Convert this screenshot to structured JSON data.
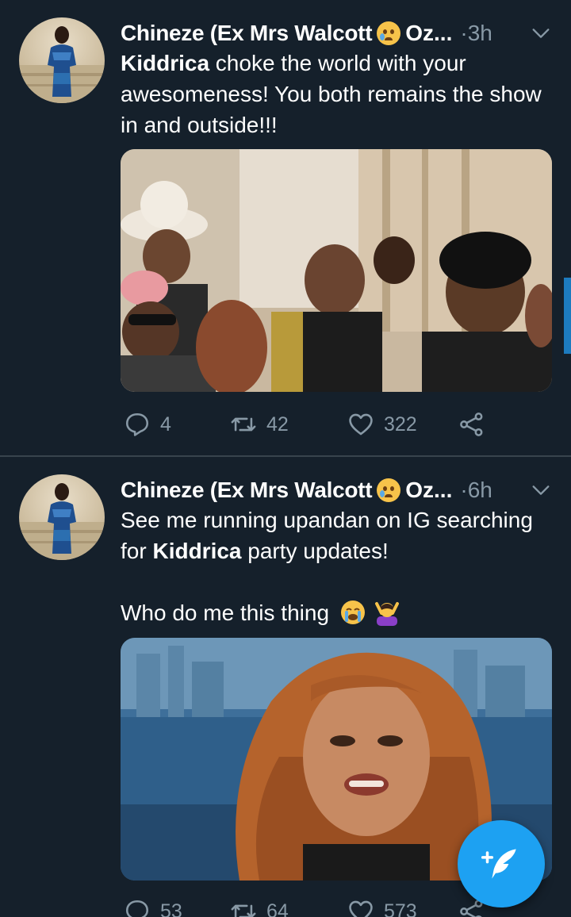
{
  "tweets": [
    {
      "author_name": "Chineze (Ex Mrs Walcott",
      "author_tail": "Oz...",
      "dot": "·",
      "time": "3h",
      "emoji": "crying-face-emoji",
      "text_parts": [
        {
          "bold": "Kiddrica"
        },
        {
          "plain": " choke the world with your awesomeness! You both remains the show in and outside!!!"
        }
      ],
      "media": "party-crowd-photo",
      "reply_count": "4",
      "retweet_count": "42",
      "like_count": "322"
    },
    {
      "author_name": "Chineze (Ex Mrs Walcott",
      "author_tail": "Oz...",
      "dot": "·",
      "time": "6h",
      "emoji": "crying-face-emoji",
      "text_line1": "See me running upandan on IG searching for ",
      "text_bold": "Kiddrica",
      "text_line1_end": " party updates!",
      "text_line2": "Who do me this thing",
      "text_line2_emojis": [
        "loudly-crying-face-emoji",
        "person-gesturing-no-emoji"
      ],
      "media": "crying-woman-photo",
      "reply_count": "53",
      "retweet_count": "64",
      "like_count": "573"
    }
  ],
  "colors": {
    "background": "#15202b",
    "divider": "#38444d",
    "secondary_text": "#8899a6",
    "accent": "#1da1f2"
  },
  "fab": {
    "icon": "compose-tweet-icon"
  }
}
